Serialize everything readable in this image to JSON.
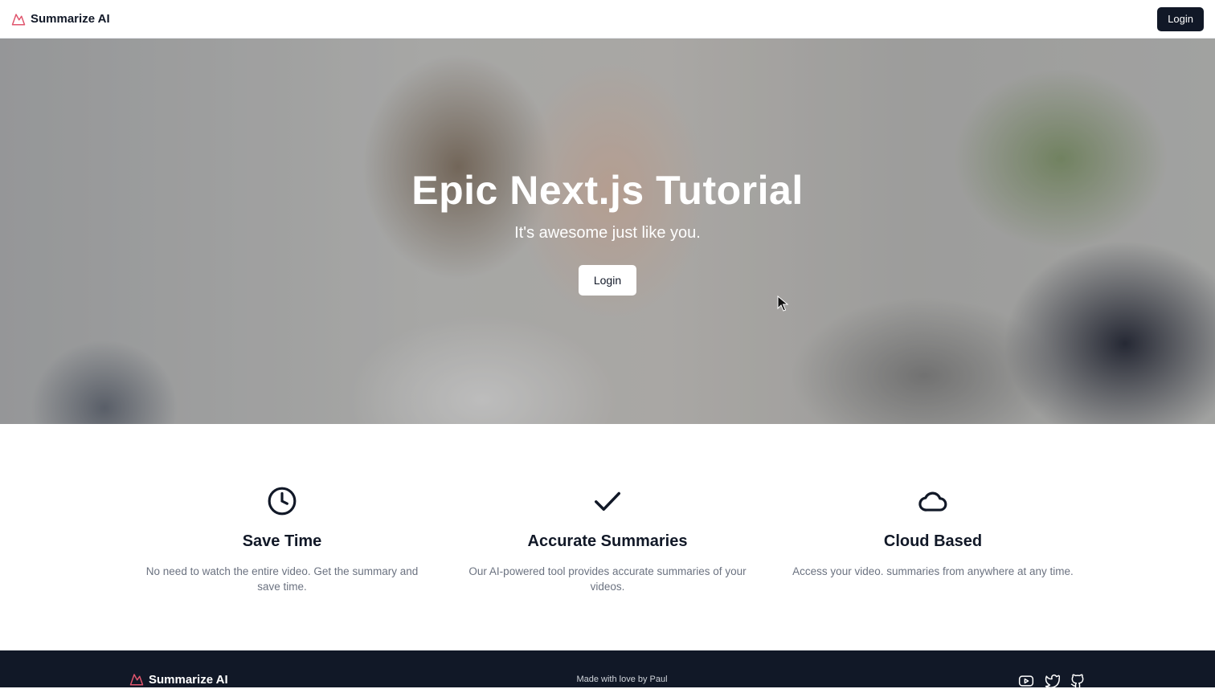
{
  "header": {
    "brand_name": "Summarize AI",
    "login_label": "Login"
  },
  "hero": {
    "title": "Epic Next.js Tutorial",
    "subtitle": "It's awesome just like you.",
    "login_label": "Login"
  },
  "features": [
    {
      "icon": "clock-icon",
      "title": "Save Time",
      "description": "No need to watch the entire video. Get the summary and save time."
    },
    {
      "icon": "check-icon",
      "title": "Accurate Summaries",
      "description": "Our AI-powered tool provides accurate summaries of your videos."
    },
    {
      "icon": "cloud-icon",
      "title": "Cloud Based",
      "description": "Access your video. summaries from anywhere at any time."
    }
  ],
  "footer": {
    "brand_name": "Summarize AI",
    "made_with": "Made with love by Paul",
    "social": [
      "youtube-icon",
      "twitter-icon",
      "github-icon"
    ]
  },
  "colors": {
    "brand_accent": "#e0556d",
    "dark": "#111827",
    "muted_text": "#6b7280"
  }
}
